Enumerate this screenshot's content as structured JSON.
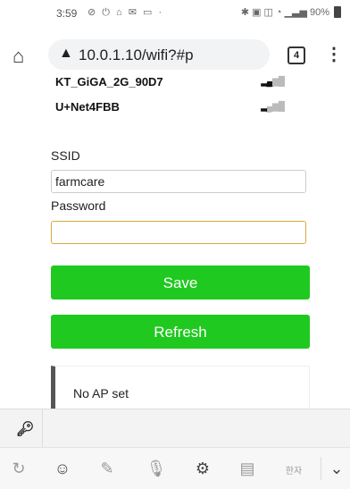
{
  "status_bar": {
    "time": "3:59",
    "battery": "90%"
  },
  "browser": {
    "url": "10.0.1.10/wifi?#p",
    "tab_count": "4"
  },
  "networks": [
    {
      "ssid": "KT_GiGA_2G_90D7"
    },
    {
      "ssid": "U+Net4FBB"
    }
  ],
  "form": {
    "ssid_label": "SSID",
    "ssid_value": "farmcare",
    "password_label": "Password",
    "password_value": "",
    "save_label": "Save",
    "refresh_label": "Refresh"
  },
  "message": "No AP set",
  "keyboard": {
    "lang_key": "한자"
  },
  "colors": {
    "button_green": "#1fc91f",
    "focus_border": "#d8a93a"
  }
}
